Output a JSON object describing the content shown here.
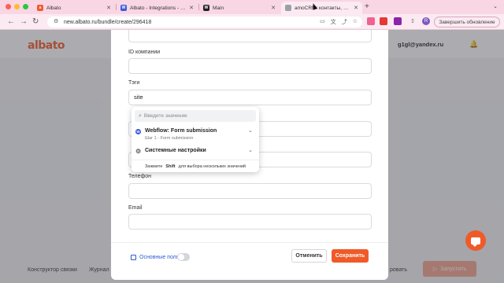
{
  "browser": {
    "tabs": [
      {
        "title": "Albato",
        "favicon_color": "#f05a28",
        "favicon_glyph": "a",
        "active": false
      },
      {
        "title": "Albato - Integrations - Webflo",
        "favicon_color": "#3b5bdb",
        "favicon_glyph": "W",
        "active": false
      },
      {
        "title": "Main",
        "favicon_color": "#222222",
        "favicon_glyph": "W",
        "active": false
      },
      {
        "title": "amoCRM: контакты, g1gl",
        "favicon_color": "#9aa0a6",
        "favicon_glyph": "",
        "active": true
      }
    ],
    "new_tab": "+",
    "url": "new.albato.ru/bundle/create/296418",
    "update_button": "Завершить обновление",
    "profile_initial": "R"
  },
  "app": {
    "logo": "albato",
    "user_email": "g1gl@yandex.ru",
    "footer_tabs": [
      "Конструктор связки",
      "Журнал",
      "ровать"
    ],
    "run_button": "Запустить"
  },
  "modal": {
    "fields": [
      {
        "label": "",
        "value": ""
      },
      {
        "label": "ID компании",
        "value": ""
      },
      {
        "label": "Тэги",
        "value": "site"
      },
      {
        "label": "",
        "value": ""
      },
      {
        "label": "",
        "value": ""
      },
      {
        "label": "Телефон",
        "value": ""
      },
      {
        "label": "Email",
        "value": ""
      }
    ],
    "core_fields_label": "Основные поля",
    "cancel_button": "Отменить",
    "save_button": "Сохранить"
  },
  "dropdown": {
    "search_placeholder": "Введите значение",
    "items": [
      {
        "title": "Webflow: Form submission",
        "subtitle": "Шаг 1 - Form submission",
        "icon": "webflow-icon"
      },
      {
        "title": "Системные настройки",
        "subtitle": "",
        "icon": "gear-icon"
      }
    ],
    "hint": {
      "pre": "Зажмите",
      "key": "Shift",
      "post": "для выбора нескольких значений"
    }
  },
  "colors": {
    "accent": "#f05a28",
    "tab_bar": "#f8d6e4",
    "link_blue": "#2f5bd2"
  }
}
